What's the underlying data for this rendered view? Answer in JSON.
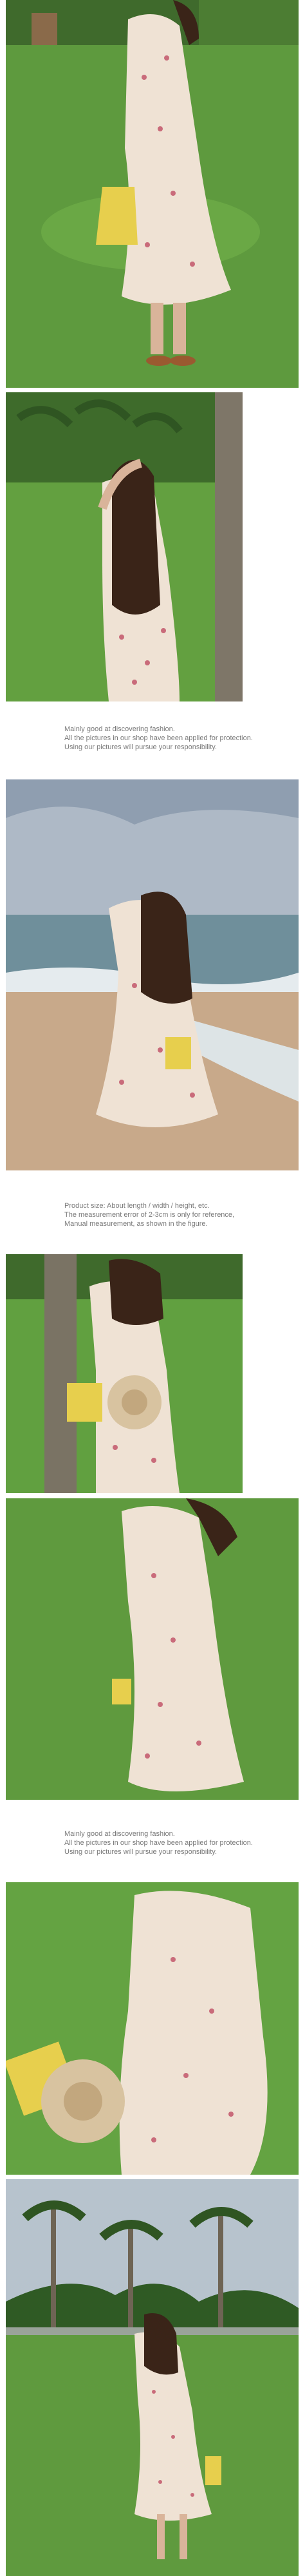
{
  "captions": [
    {
      "lines": [
        "Mainly good at discovering fashion.",
        "All the pictures in our shop have been applied for protection.",
        "Using our pictures will pursue your responsibility."
      ]
    },
    {
      "lines": [
        "Product size: About length / width / height, etc.",
        "The measurement error of 2-3cm is only for reference,",
        "Manual measurement, as shown in the figure."
      ]
    },
    {
      "lines": [
        "Mainly good at discovering fashion.",
        "All the pictures in our shop have been applied for protection.",
        "Using our pictures will pursue your responsibility."
      ]
    }
  ],
  "colors": {
    "grass": "#5f9a3e",
    "sky": "#aeb9c6",
    "sea": "#6f8f9b",
    "sand": "#c8a98a",
    "dress": "#efe2d4",
    "hair": "#3a2418",
    "bag": "#e7cf4d"
  }
}
